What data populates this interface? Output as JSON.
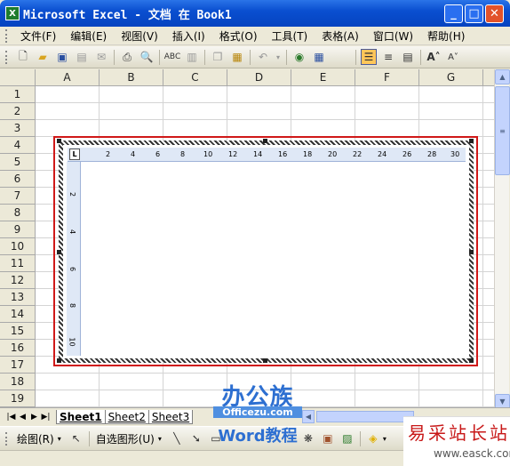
{
  "window": {
    "title": "Microsoft Excel - 文档 在 Book1",
    "app_icon": "excel-icon"
  },
  "menu": [
    "文件(F)",
    "编辑(E)",
    "视图(V)",
    "插入(I)",
    "格式(O)",
    "工具(T)",
    "表格(A)",
    "窗口(W)",
    "帮助(H)"
  ],
  "columns": [
    "A",
    "B",
    "C",
    "D",
    "E",
    "F",
    "G"
  ],
  "rows": [
    "1",
    "2",
    "3",
    "4",
    "5",
    "6",
    "7",
    "8",
    "9",
    "10",
    "11",
    "12",
    "13",
    "14",
    "15",
    "16",
    "17",
    "18",
    "19"
  ],
  "ruler": {
    "h_ticks": [
      "2",
      "4",
      "6",
      "8",
      "10",
      "12",
      "14",
      "16",
      "18",
      "20",
      "22",
      "24",
      "26",
      "28",
      "30"
    ],
    "v_ticks": [
      "2",
      "4",
      "6",
      "8",
      "10"
    ],
    "corner": "L"
  },
  "sheets": [
    "Sheet1",
    "Sheet2",
    "Sheet3"
  ],
  "drawbar": {
    "draw_label": "绘图(R)",
    "autoshape_label": "自选图形(U)"
  },
  "watermarks": {
    "bangong": "办公族",
    "bangong_url": "Officezu.com",
    "word": "Word教程",
    "yicai": "易采站长站",
    "yicai_url": "www.easck.com"
  },
  "colors": {
    "title_bar": "#0a4fd0",
    "selection_frame": "#d01818",
    "watermark_red": "#c81818"
  }
}
